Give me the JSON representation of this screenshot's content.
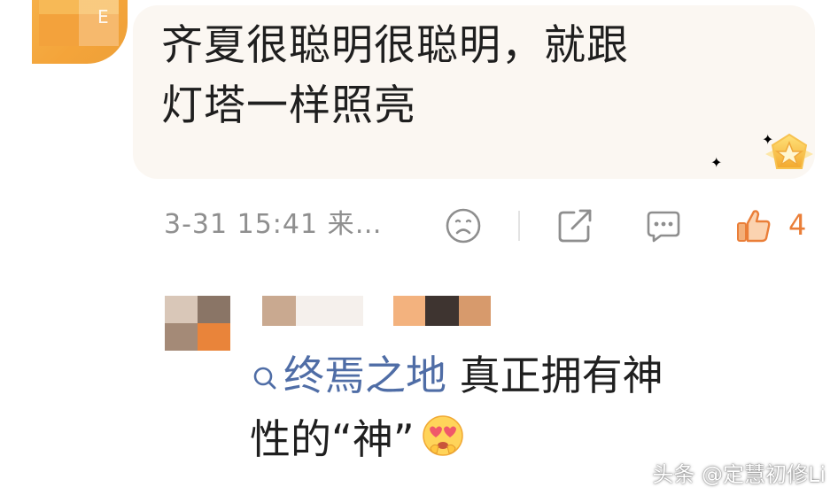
{
  "comment": {
    "text_line1": "齐夏很聪明很聪明，就跟",
    "text_line2": "灯塔一样照亮",
    "bubble_color": "#fbf7f2"
  },
  "actions": {
    "timestamp": "3-31 15:41 来…",
    "icons": [
      "dislike-face-icon",
      "share-icon",
      "reply-icon",
      "like-icon"
    ],
    "like_count": "4",
    "like_color": "#ea7e38"
  },
  "reply": {
    "mention": "终焉之地",
    "text_line1_rest": " 真正拥有神",
    "text_line2": "性的“神”",
    "mention_color": "#4f6da6",
    "emoji": "heart-eyes-emoji"
  },
  "badge": {
    "icon": "star-badge-icon"
  },
  "watermark": {
    "text": "头条 @定慧初修Li"
  }
}
